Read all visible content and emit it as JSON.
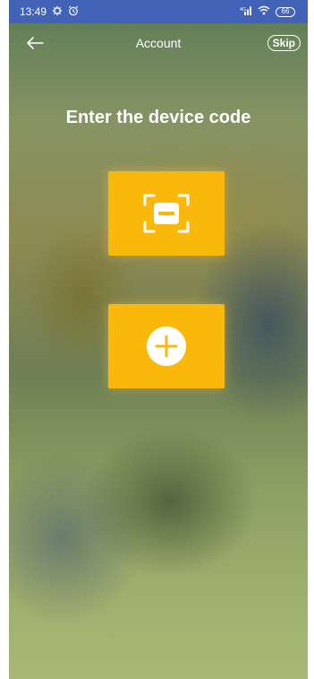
{
  "status_bar": {
    "time": "13:49",
    "notification_icons": [
      "settings-icon",
      "alarm-icon"
    ],
    "signal_label": "⁴ᴳ",
    "battery_level": "66"
  },
  "nav": {
    "title": "Account",
    "back_icon": "arrow-left-icon",
    "skip_label": "Skip"
  },
  "main": {
    "heading": "Enter the device code",
    "actions": [
      {
        "icon": "scan-frame-icon"
      },
      {
        "icon": "plus-circle-icon"
      }
    ]
  },
  "colors": {
    "status_bar_bg": "#4262b8",
    "tile_bg": "#f9b80a",
    "text": "#ffffff"
  }
}
